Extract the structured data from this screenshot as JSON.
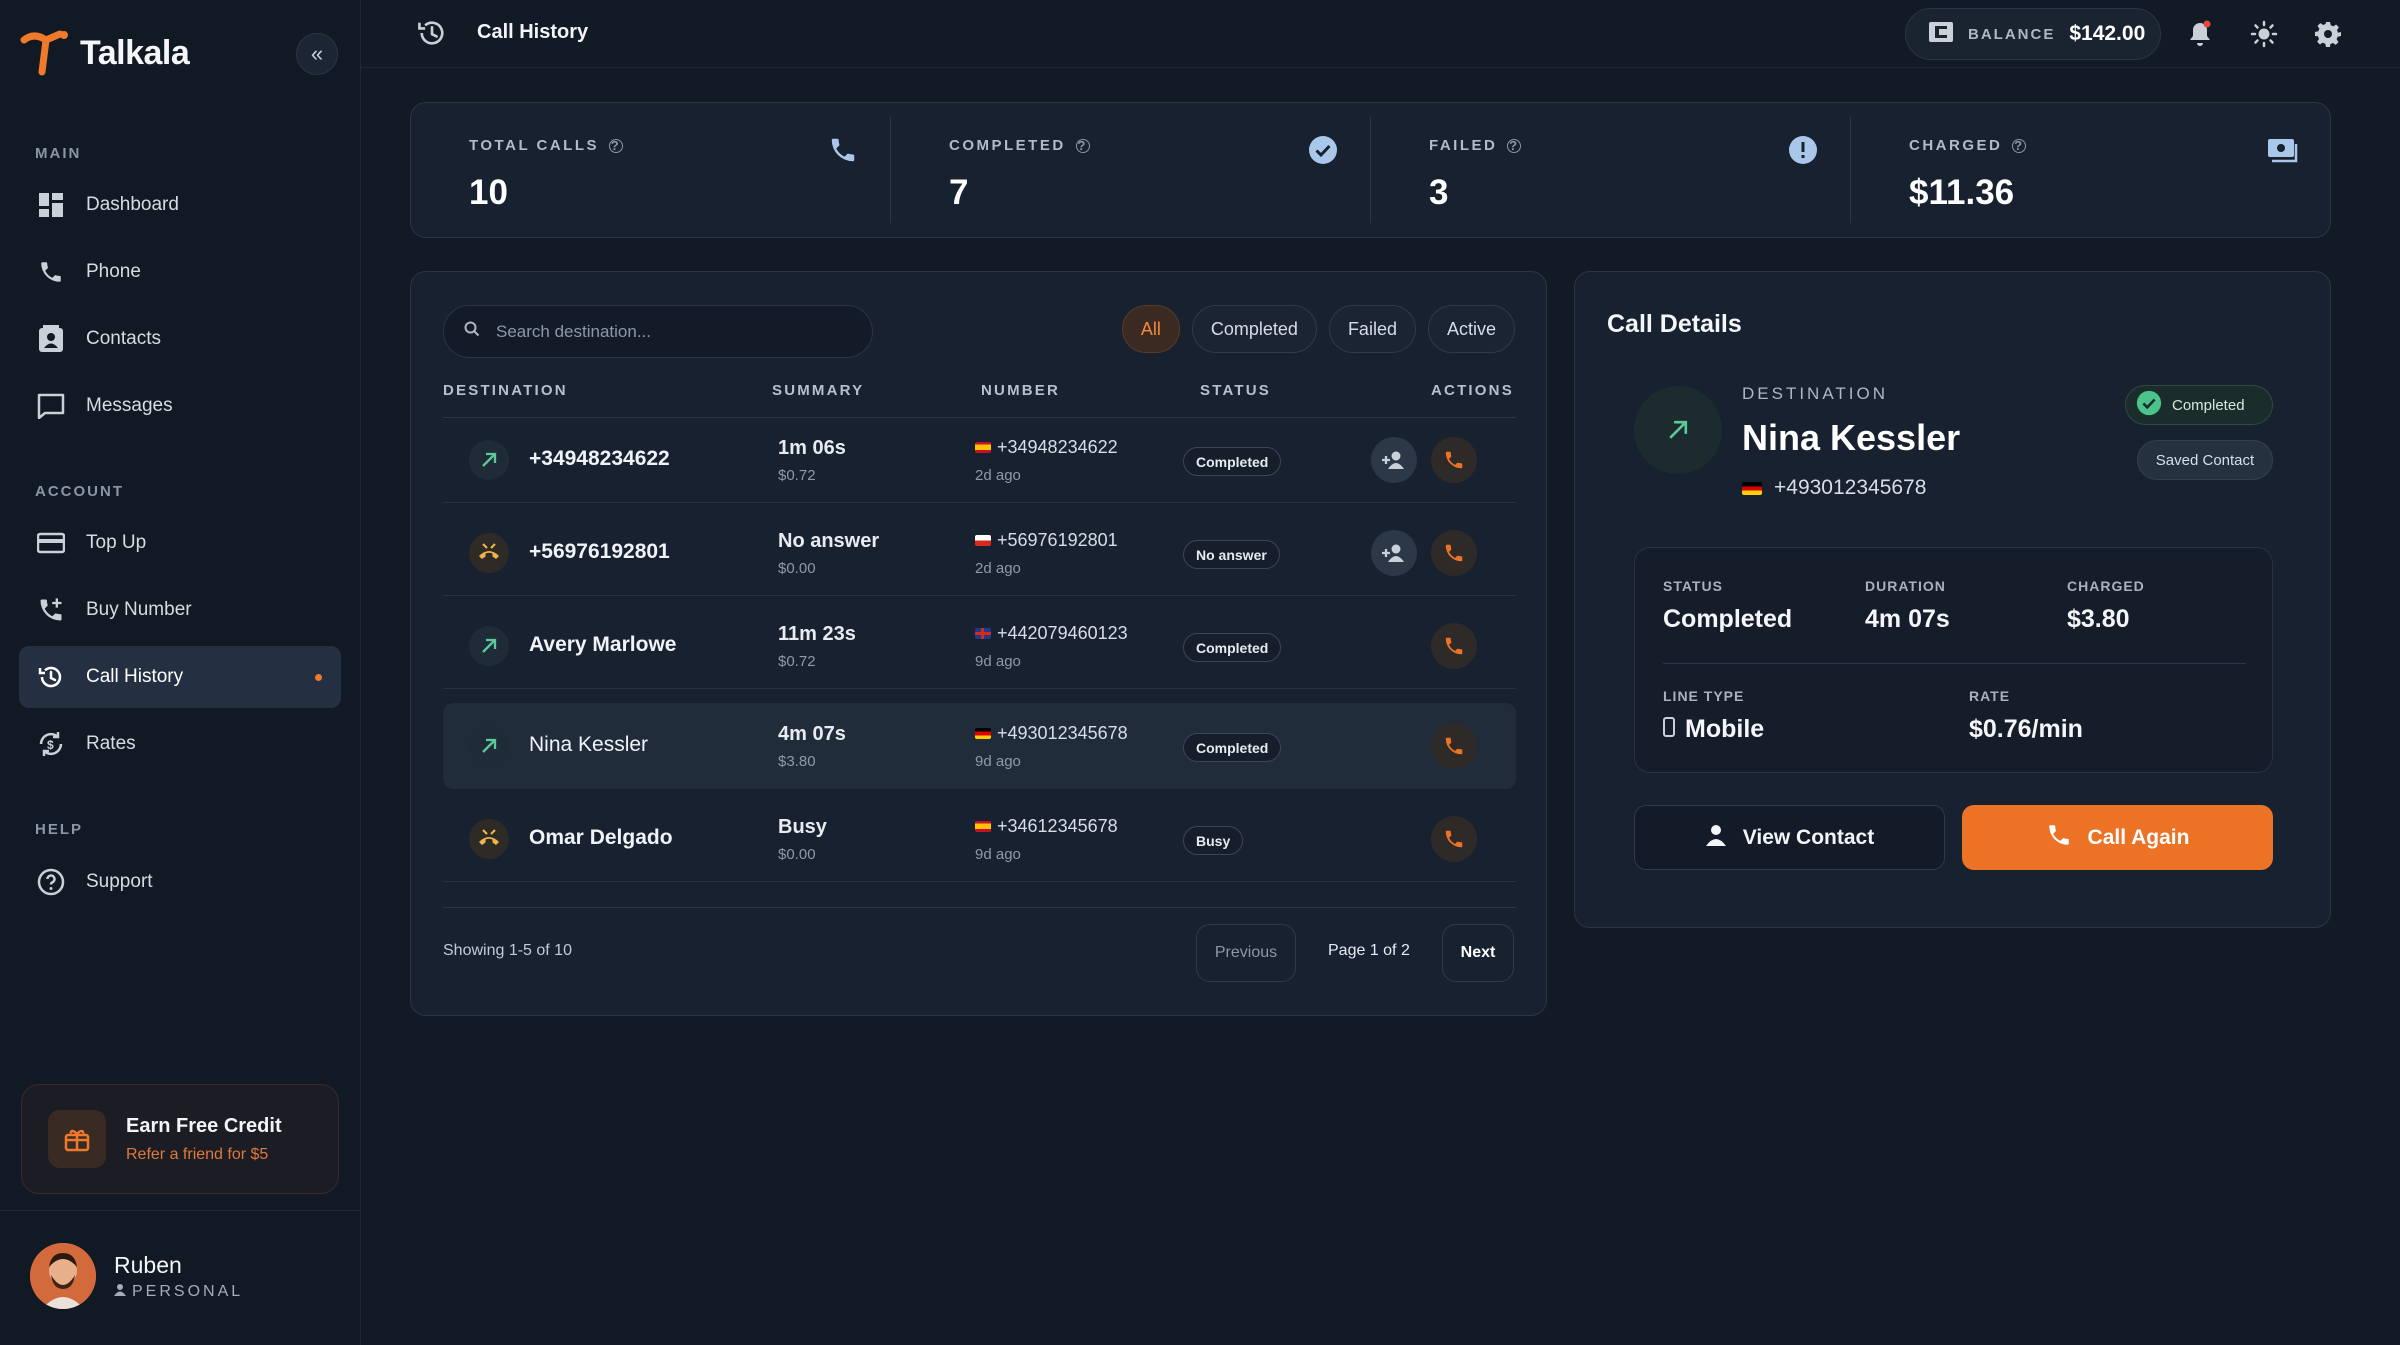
{
  "app": {
    "brand": "Talkala",
    "accent": "#ec7325"
  },
  "sidebar": {
    "sections": {
      "main": "MAIN",
      "account": "ACCOUNT",
      "help": "HELP"
    },
    "items": [
      {
        "label": "Dashboard",
        "icon": "dashboard-icon"
      },
      {
        "label": "Phone",
        "icon": "phone-icon"
      },
      {
        "label": "Contacts",
        "icon": "contacts-icon"
      },
      {
        "label": "Messages",
        "icon": "messages-icon"
      },
      {
        "label": "Top Up",
        "icon": "card-icon"
      },
      {
        "label": "Buy Number",
        "icon": "phone-plus-icon"
      },
      {
        "label": "Call History",
        "icon": "history-icon",
        "active": true
      },
      {
        "label": "Rates",
        "icon": "rates-icon"
      },
      {
        "label": "Support",
        "icon": "support-icon"
      }
    ],
    "promo": {
      "title": "Earn Free Credit",
      "subtitle": "Refer a friend for $5"
    },
    "user": {
      "name": "Ruben",
      "plan": "PERSONAL"
    }
  },
  "topbar": {
    "title": "Call History",
    "balance_label": "BALANCE",
    "balance_value": "$142.00"
  },
  "stats": [
    {
      "label": "TOTAL CALLS",
      "value": "10",
      "icon": "phone-icon"
    },
    {
      "label": "COMPLETED",
      "value": "7",
      "icon": "check-circle-icon"
    },
    {
      "label": "FAILED",
      "value": "3",
      "icon": "alert-circle-icon"
    },
    {
      "label": "CHARGED",
      "value": "$11.36",
      "icon": "money-icon"
    }
  ],
  "list": {
    "search_placeholder": "Search destination...",
    "filters": [
      "All",
      "Completed",
      "Failed",
      "Active"
    ],
    "active_filter": "All",
    "columns": {
      "destination": "DESTINATION",
      "summary": "SUMMARY",
      "number": "NUMBER",
      "status": "STATUS",
      "actions": "ACTIONS"
    },
    "rows": [
      {
        "destination": "+34948234622",
        "summary": "1m 06s",
        "cost": "$0.72",
        "number": "+34948234622",
        "when": "2d ago",
        "status": "Completed",
        "direction": "outgoing-icon",
        "flag": "ES"
      },
      {
        "destination": "+56976192801",
        "summary": "No answer",
        "cost": "$0.00",
        "number": "+56976192801",
        "when": "2d ago",
        "status": "No answer",
        "direction": "missed-call-icon",
        "flag": "CL"
      },
      {
        "destination": "Avery Marlowe",
        "summary": "11m 23s",
        "cost": "$0.72",
        "number": "+442079460123",
        "when": "9d ago",
        "status": "Completed",
        "direction": "outgoing-icon",
        "flag": "GB"
      },
      {
        "destination": "Nina Kessler",
        "summary": "4m 07s",
        "cost": "$3.80",
        "number": "+493012345678",
        "when": "9d ago",
        "status": "Completed",
        "direction": "outgoing-icon",
        "flag": "DE"
      },
      {
        "destination": "Omar Delgado",
        "summary": "Busy",
        "cost": "$0.00",
        "number": "+34612345678",
        "when": "9d ago",
        "status": "Busy",
        "direction": "missed-call-icon",
        "flag": "ES"
      }
    ],
    "showing": "Showing 1-5 of 10",
    "prev": "Previous",
    "page": "Page 1 of 2",
    "next": "Next"
  },
  "details": {
    "title": "Call Details",
    "dest_label": "DESTINATION",
    "name": "Nina Kessler",
    "number": "+493012345678",
    "status_badge": "Completed",
    "saved_badge": "Saved Contact",
    "status_label": "STATUS",
    "status_value": "Completed",
    "duration_label": "DURATION",
    "duration_value": "4m 07s",
    "charged_label": "CHARGED",
    "charged_value": "$3.80",
    "line_label": "LINE TYPE",
    "line_value": "Mobile",
    "rate_label": "RATE",
    "rate_value": "$0.76/min",
    "view_contact": "View Contact",
    "call_again": "Call Again"
  }
}
